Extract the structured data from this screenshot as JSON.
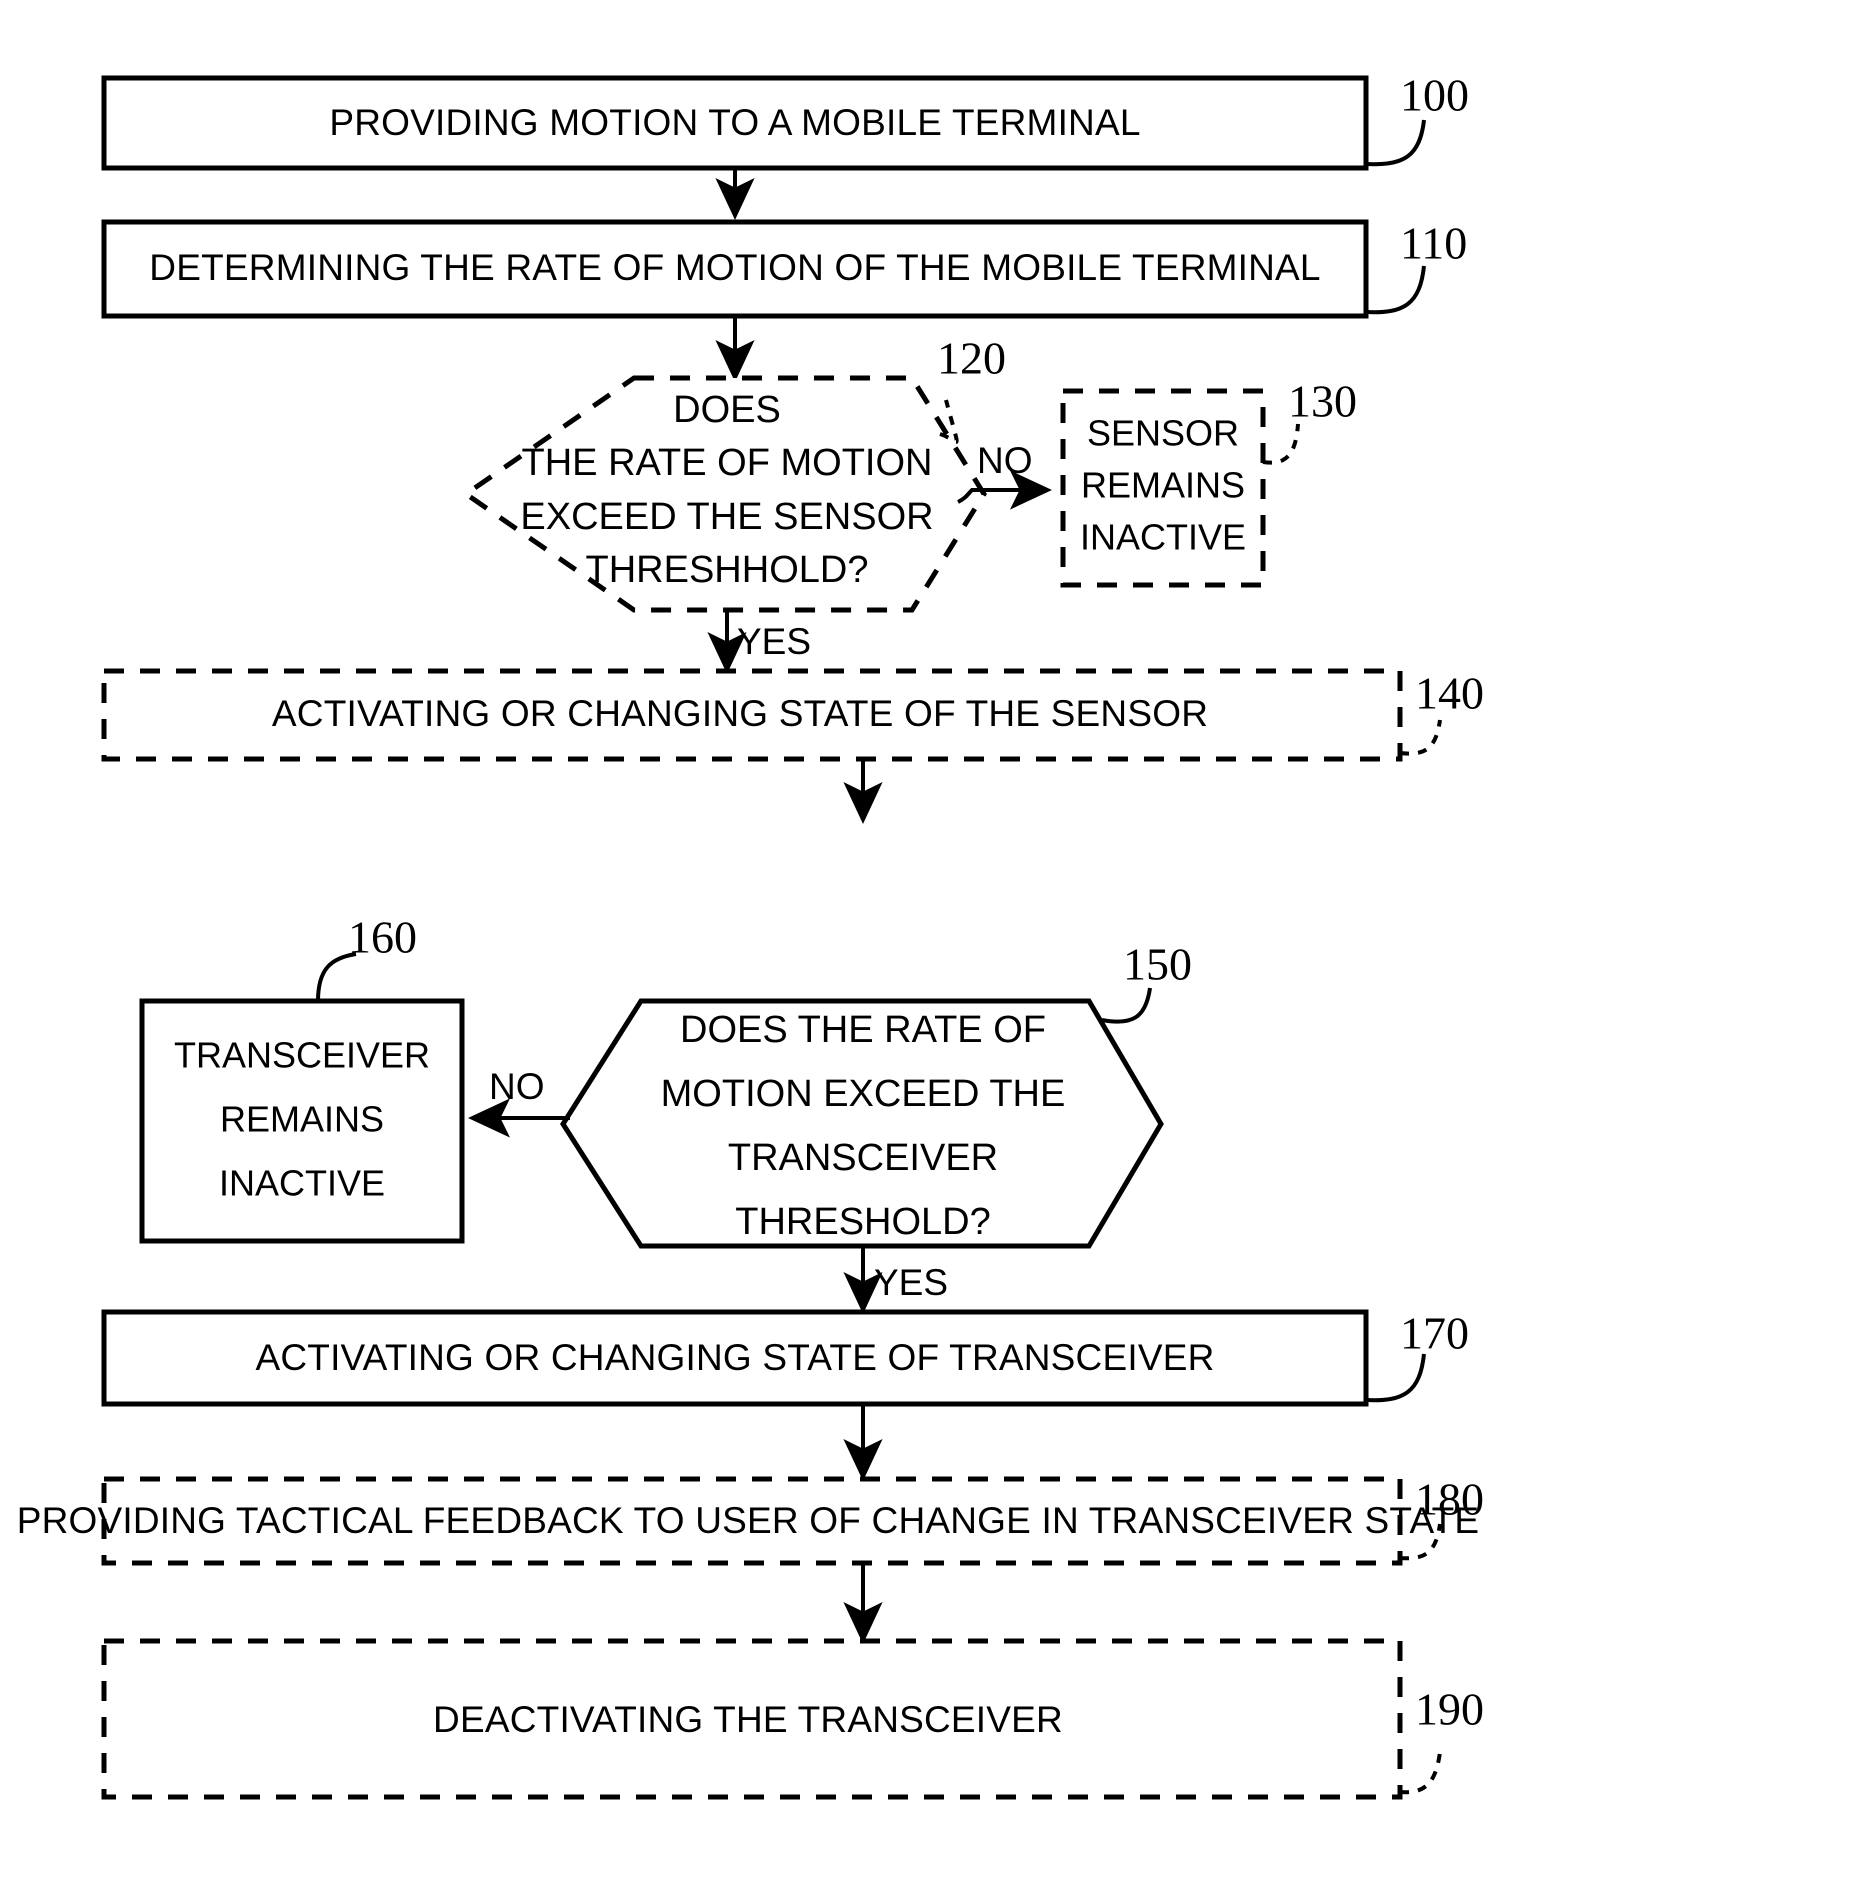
{
  "figure": {
    "type": "patent-flowchart",
    "background_color": "#ffffff",
    "line_color": "#000000"
  },
  "nodes": [
    {
      "id": "n100",
      "ref": "100",
      "shape": "rectangle",
      "border": "solid",
      "lines": [
        "PROVIDING MOTION TO A MOBILE TERMINAL"
      ]
    },
    {
      "id": "n110",
      "ref": "110",
      "shape": "rectangle",
      "border": "solid",
      "lines": [
        "DETERMINING THE RATE OF MOTION OF THE MOBILE TERMINAL"
      ]
    },
    {
      "id": "n120",
      "ref": "120",
      "shape": "hexagon",
      "border": "dashed",
      "lines": [
        "DOES",
        "THE RATE OF MOTION",
        "EXCEED THE SENSOR",
        "THRESHHOLD?"
      ]
    },
    {
      "id": "n130",
      "ref": "130",
      "shape": "rectangle",
      "border": "dashed",
      "lines": [
        "SENSOR",
        "REMAINS",
        "INACTIVE"
      ]
    },
    {
      "id": "n140",
      "ref": "140",
      "shape": "rectangle",
      "border": "dashed",
      "lines": [
        "ACTIVATING OR CHANGING STATE OF THE SENSOR"
      ]
    },
    {
      "id": "n150",
      "ref": "150",
      "shape": "hexagon",
      "border": "solid",
      "lines": [
        "DOES THE RATE OF",
        "MOTION EXCEED THE",
        "TRANSCEIVER",
        "THRESHOLD?"
      ]
    },
    {
      "id": "n160",
      "ref": "160",
      "shape": "rectangle",
      "border": "solid",
      "lines": [
        "TRANSCEIVER",
        "REMAINS",
        "INACTIVE"
      ]
    },
    {
      "id": "n170",
      "ref": "170",
      "shape": "rectangle",
      "border": "solid",
      "lines": [
        "ACTIVATING OR CHANGING STATE OF TRANSCEIVER"
      ]
    },
    {
      "id": "n180",
      "ref": "180",
      "shape": "rectangle",
      "border": "dashed",
      "lines": [
        "PROVIDING TACTICAL FEEDBACK TO USER OF CHANGE IN TRANSCEIVER STATE"
      ]
    },
    {
      "id": "n190",
      "ref": "190",
      "shape": "rectangle",
      "border": "dashed",
      "lines": [
        "DEACTIVATING THE TRANSCEIVER"
      ]
    }
  ],
  "edge_labels": {
    "no_120_to_130": "NO",
    "yes_120_to_140": "YES",
    "no_150_to_160": "NO",
    "yes_150_to_170": "YES"
  },
  "ref_numbers": {
    "r100": "100",
    "r110": "110",
    "r120": "120",
    "r130": "130",
    "r140": "140",
    "r150": "150",
    "r160": "160",
    "r170": "170",
    "r180": "180",
    "r190": "190"
  }
}
